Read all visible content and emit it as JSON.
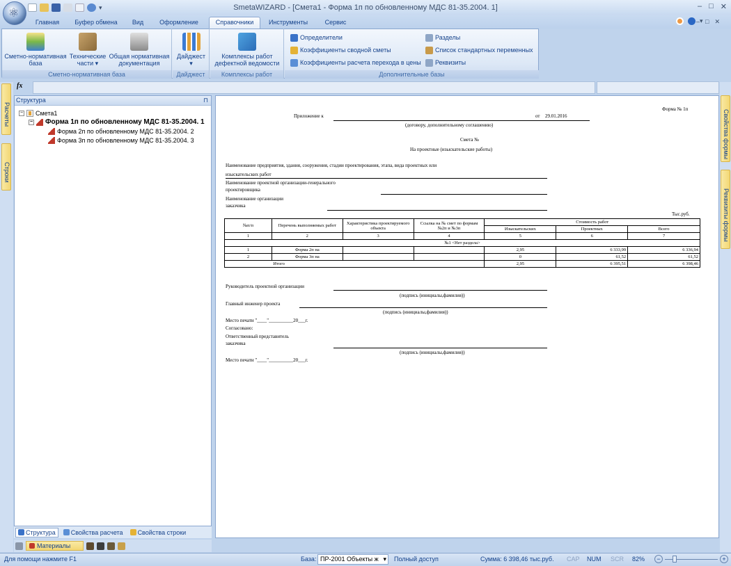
{
  "app": {
    "title": "SmetaWIZARD - [Смета1 - Форма 1п по обновленному МДС 81-35.2004. 1]",
    "orb_icon": "app-orb-icon"
  },
  "window_controls": {
    "min": "–",
    "max": "□",
    "close": "✕"
  },
  "ribbon_tabs": [
    "Главная",
    "Буфер обмена",
    "Вид",
    "Оформление",
    "Справочники",
    "Инструменты",
    "Сервис"
  ],
  "active_tab": "Справочники",
  "ribbon": {
    "groups": [
      {
        "label": "Сметно-нормативная база"
      },
      {
        "label": "Дайджест"
      },
      {
        "label": "Комплексы работ"
      },
      {
        "label": "Дополнительные базы"
      }
    ],
    "buttons": {
      "base_line1": "Сметно-нормативная",
      "base_line2": "база",
      "tech_line1": "Технические",
      "tech_line2": "части",
      "docs_line1": "Общая нормативная",
      "docs_line2": "документация",
      "digest": "Дайджест",
      "complex_line1": "Комплексы работ",
      "complex_line2": "дефектной ведомости",
      "determinants": "Определители",
      "coef_summary": "Коэффициенты сводной сметы",
      "coef_transition": "Коэффициенты расчета перехода в цены",
      "sections": "Разделы",
      "std_vars": "Список стандартных переменных",
      "requisites": "Реквизиты"
    }
  },
  "formula_bar": {
    "fx": "fx"
  },
  "left_vertical_tabs": [
    "Расчеты",
    "Строки"
  ],
  "right_vertical_tabs": [
    "Свойства формы",
    "Реквизиты формы"
  ],
  "structure_panel": {
    "title": "Структура",
    "pin": "⊓",
    "tree": [
      {
        "label": "Смета1",
        "level": 0
      },
      {
        "label": "Форма 1п по обновленному МДС 81-35.2004. 1",
        "level": 1
      },
      {
        "label": "Форма 2п по обновленному МДС 81-35.2004. 2",
        "level": 2
      },
      {
        "label": "Форма 3п по обновленному МДС 81-35.2004. 3",
        "level": 2
      }
    ],
    "tabs": [
      "Структура",
      "Свойства расчета",
      "Свойства строки"
    ],
    "bottom_label": "Материалы"
  },
  "document": {
    "form_no": "Форма № 1п",
    "appendix": "Приложение к",
    "date_prefix": "от",
    "date": "29.01.2016",
    "contract_note": "(договору, дополнительному соглашению)",
    "smeta_title": "Смета №",
    "smeta_subtitle": "На проектные (изыскательские работы)",
    "object_label_1": "Наименование предприятия, здания, сооружения, стадии проектирования, этапа, вида проектных или",
    "object_label_2": "изыскательских работ",
    "org_label_1": "Наименование проектной организации-генерального",
    "org_label_2": "проектировщика",
    "customer_label_1": "Наименование организации",
    "customer_label_2": "заказчика",
    "units": "Тыс.руб.",
    "table": {
      "h_num": "№п/п",
      "h_list": "Перечень выполняемых работ",
      "h_char": "Характеристика проектируемого объекта",
      "h_ref": "Ссылка на № смет по формам №2п и №3п",
      "h_cost": "Стоимость работ",
      "h_survey": "Изыскательских",
      "h_design": "Проектных",
      "h_total": "Всего",
      "col_nums": [
        "1",
        "2",
        "3",
        "4",
        "5",
        "6",
        "7"
      ],
      "section": "№1 <Нет раздела>",
      "rows": [
        {
          "n": "1",
          "name": "Форма 2п  на",
          "char": "",
          "ref": "",
          "survey": "2,95",
          "design": "6 333,99",
          "total": "6 336,94"
        },
        {
          "n": "2",
          "name": "Форма 3п  на",
          "char": "",
          "ref": "",
          "survey": "0",
          "design": "61,52",
          "total": "61,52"
        }
      ],
      "total_row": {
        "label": "Итого",
        "survey": "2,95",
        "design": "6 395,51",
        "total": "6 398,46"
      }
    },
    "head_org": "Руководитель проектной организации",
    "sign_note": "(подпись (инициалы,фамилия))",
    "chief_engineer": "Главный инженер проекта",
    "stamp_place": "Место печати  \"____\"__________20___г.",
    "agreed": "Согласовано:",
    "rep_label_1": "Ответственный представитель",
    "rep_label_2": "заказчика"
  },
  "statusbar": {
    "help": "Для помощи нажмите F1",
    "base_label": "База:",
    "base_value": "ПР-2001 Объекты ж",
    "access": "Полный доступ",
    "sum": "Сумма: 6 398,46 тыс.руб.",
    "cap": "CAP",
    "num": "NUM",
    "scr": "SCR",
    "zoom": "82%"
  }
}
